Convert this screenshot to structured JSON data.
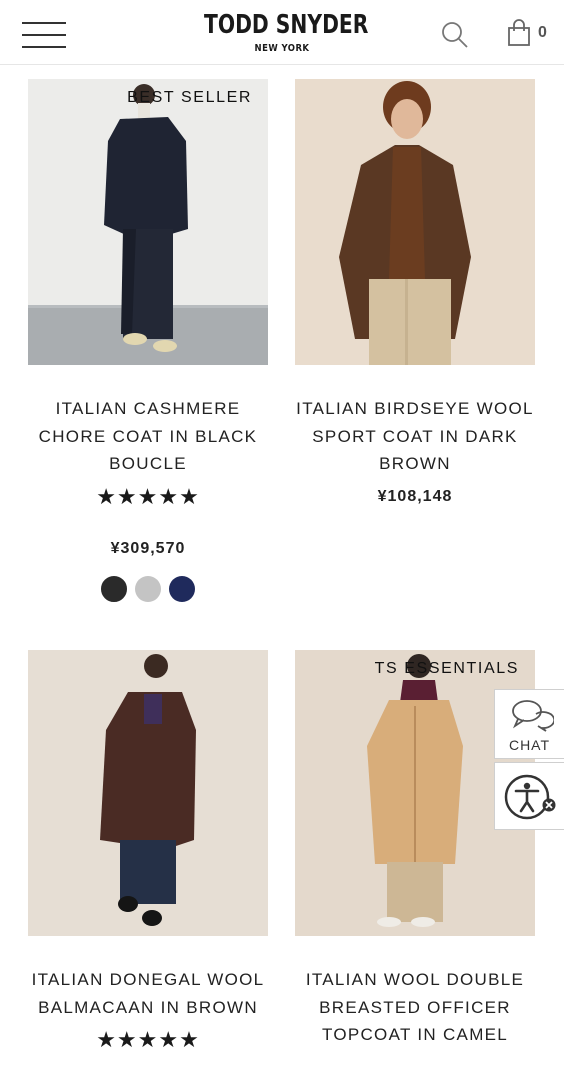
{
  "header": {
    "brand_name": "TODD SNYDER",
    "brand_sub": "NEW YORK",
    "cart_count": "0",
    "icons": [
      "menu-icon",
      "search-icon",
      "shopping-bag-icon"
    ]
  },
  "products": [
    {
      "badge": "BEST SELLER",
      "name": "ITALIAN CASHMERE CHORE COAT IN BLACK BOUCLE",
      "rating_stars": "★★★★★",
      "rating_value": 5,
      "price": "¥309,570",
      "swatches": [
        "#2a2a2a",
        "#c4c4c4",
        "#1f2a5c"
      ]
    },
    {
      "badge": "",
      "name": "ITALIAN BIRDSEYE WOOL SPORT COAT IN DARK BROWN",
      "rating_stars": "",
      "price": "¥108,148",
      "swatches": []
    },
    {
      "badge": "",
      "name": "ITALIAN DONEGAL WOOL BALMACAAN IN BROWN",
      "rating_stars": "★★★★★",
      "rating_value": 5
    },
    {
      "badge": "TS ESSENTIALS",
      "name": "ITALIAN WOOL DOUBLE BREASTED OFFICER TOPCOAT IN CAMEL"
    }
  ],
  "widgets": {
    "chat_label": "CHAT",
    "chat_icon": "chat-bubbles-icon",
    "accessibility_icon": "accessibility-icon"
  },
  "colors": {
    "text": "#222222",
    "photo_bg_1": "#ececea",
    "photo_bg_2": "#e9dccd",
    "photo_bg_3": "#e6ded4",
    "photo_bg_4": "#e4d9cc"
  }
}
